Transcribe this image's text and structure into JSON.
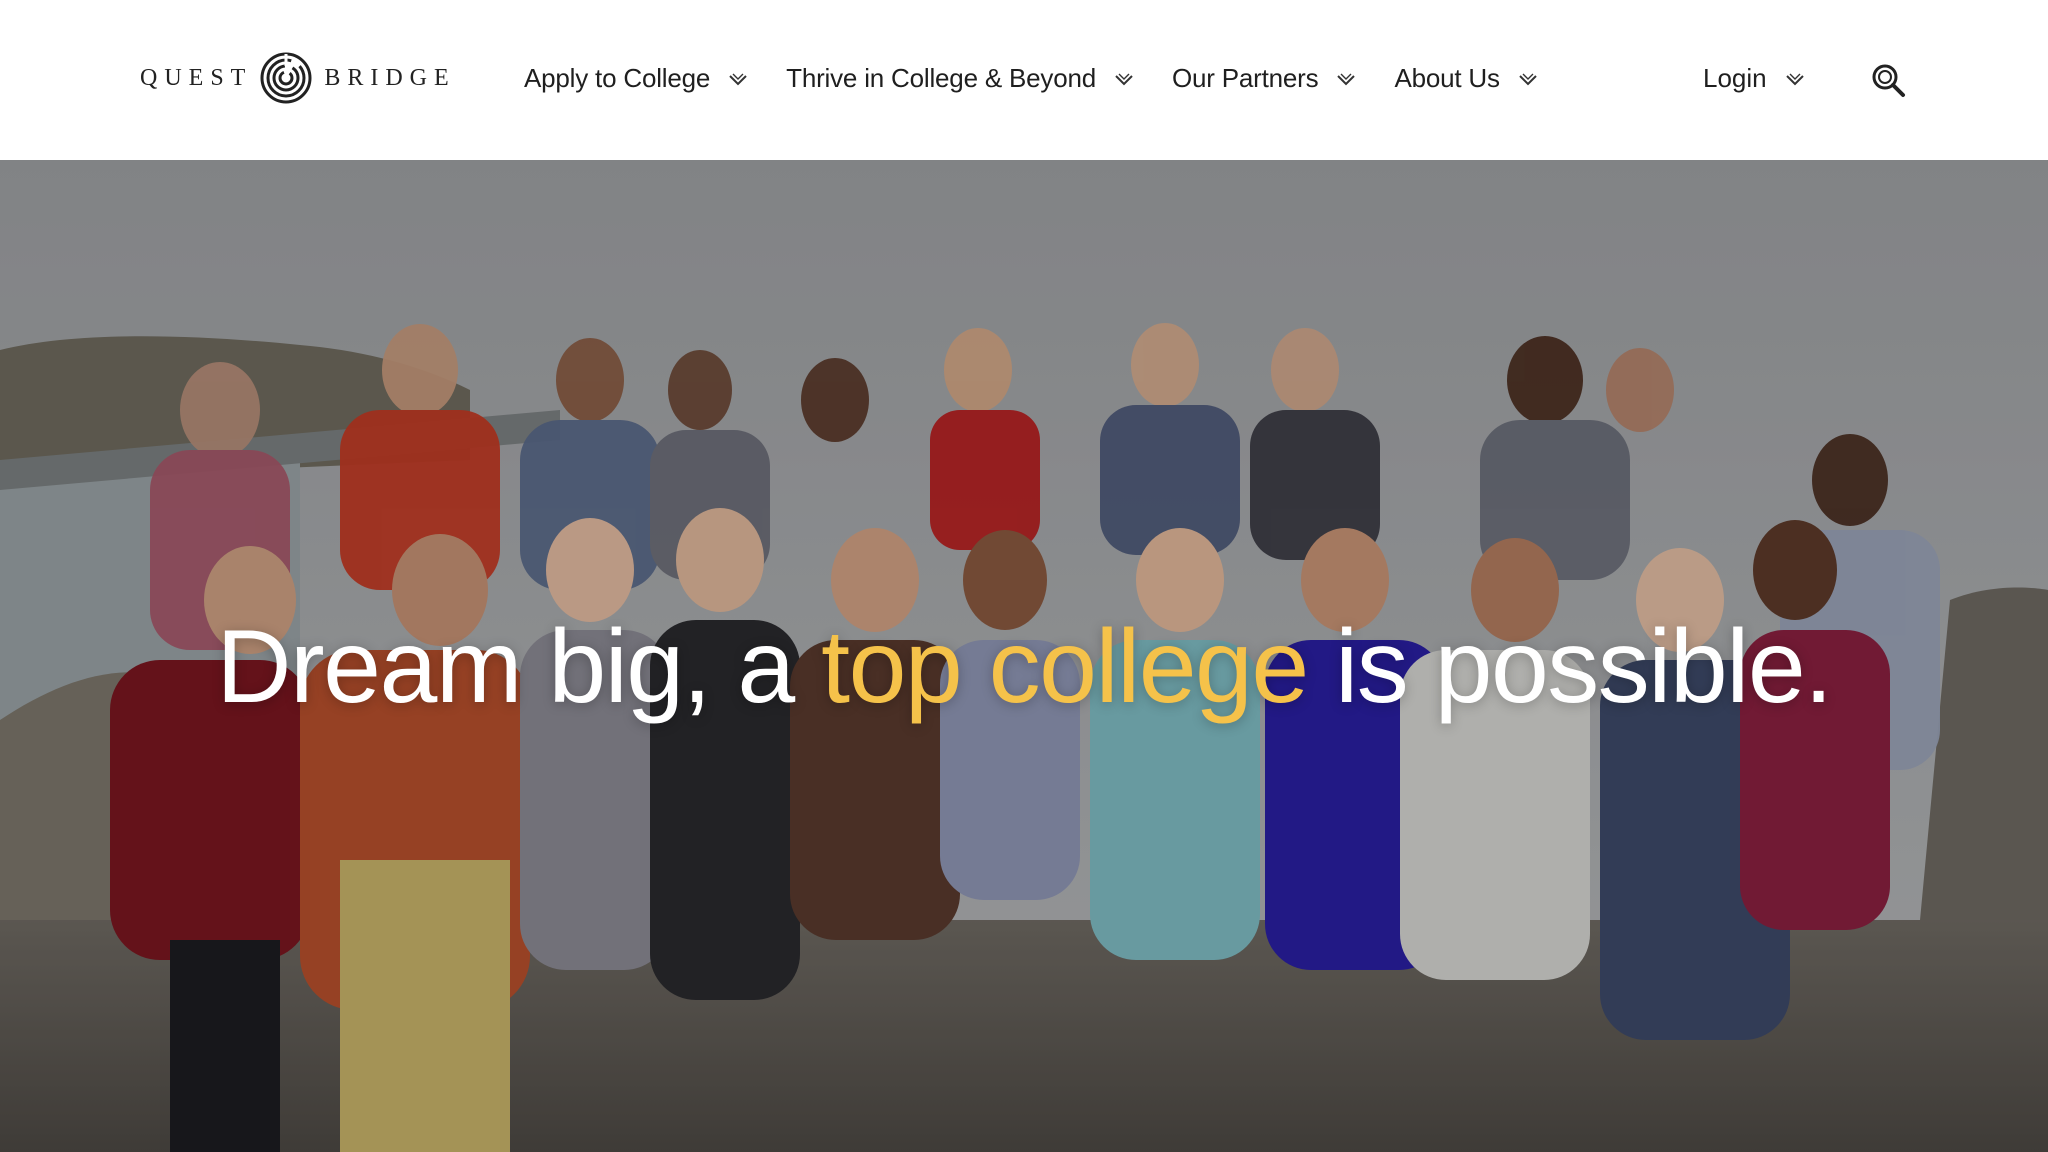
{
  "brand": {
    "name_left": "QUEST",
    "name_right": "BRIDGE",
    "logo_icon": "labyrinth-circle-icon"
  },
  "nav": {
    "items": [
      {
        "label": "Apply to College"
      },
      {
        "label": "Thrive in College & Beyond"
      },
      {
        "label": "Our Partners"
      },
      {
        "label": "About Us"
      }
    ],
    "login_label": "Login",
    "search_icon": "search-icon",
    "chevron_icon": "chevron-down-icon"
  },
  "hero": {
    "headline_before": "Dream big, a ",
    "headline_accent": "top college",
    "headline_after": " is possible.",
    "image_subject": "group photo of students outdoors by the bay",
    "accent_color": "#f5c24a",
    "text_color": "#ffffff"
  }
}
